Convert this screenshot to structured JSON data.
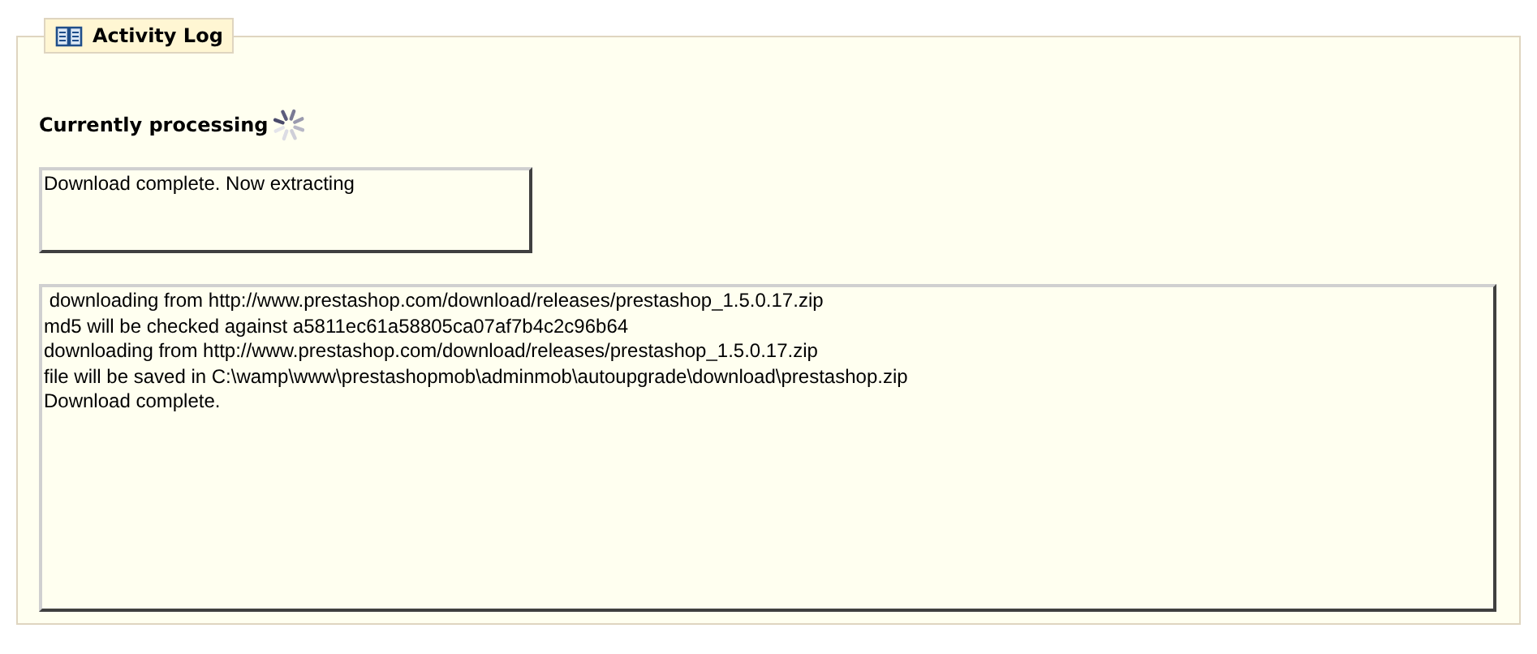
{
  "panel": {
    "title": "Activity Log"
  },
  "processing": {
    "label": "Currently processing",
    "busy": true
  },
  "status_box": {
    "text": "Download complete. Now extracting"
  },
  "log": {
    "lines": [
      " downloading from http://www.prestashop.com/download/releases/prestashop_1.5.0.17.zip",
      "md5 will be checked against a5811ec61a58805ca07af7b4c2c96b64",
      "downloading from http://www.prestashop.com/download/releases/prestashop_1.5.0.17.zip",
      "file will be saved in C:\\wamp\\www\\prestashopmob\\adminmob\\autoupgrade\\download\\prestashop.zip",
      "Download complete."
    ]
  }
}
